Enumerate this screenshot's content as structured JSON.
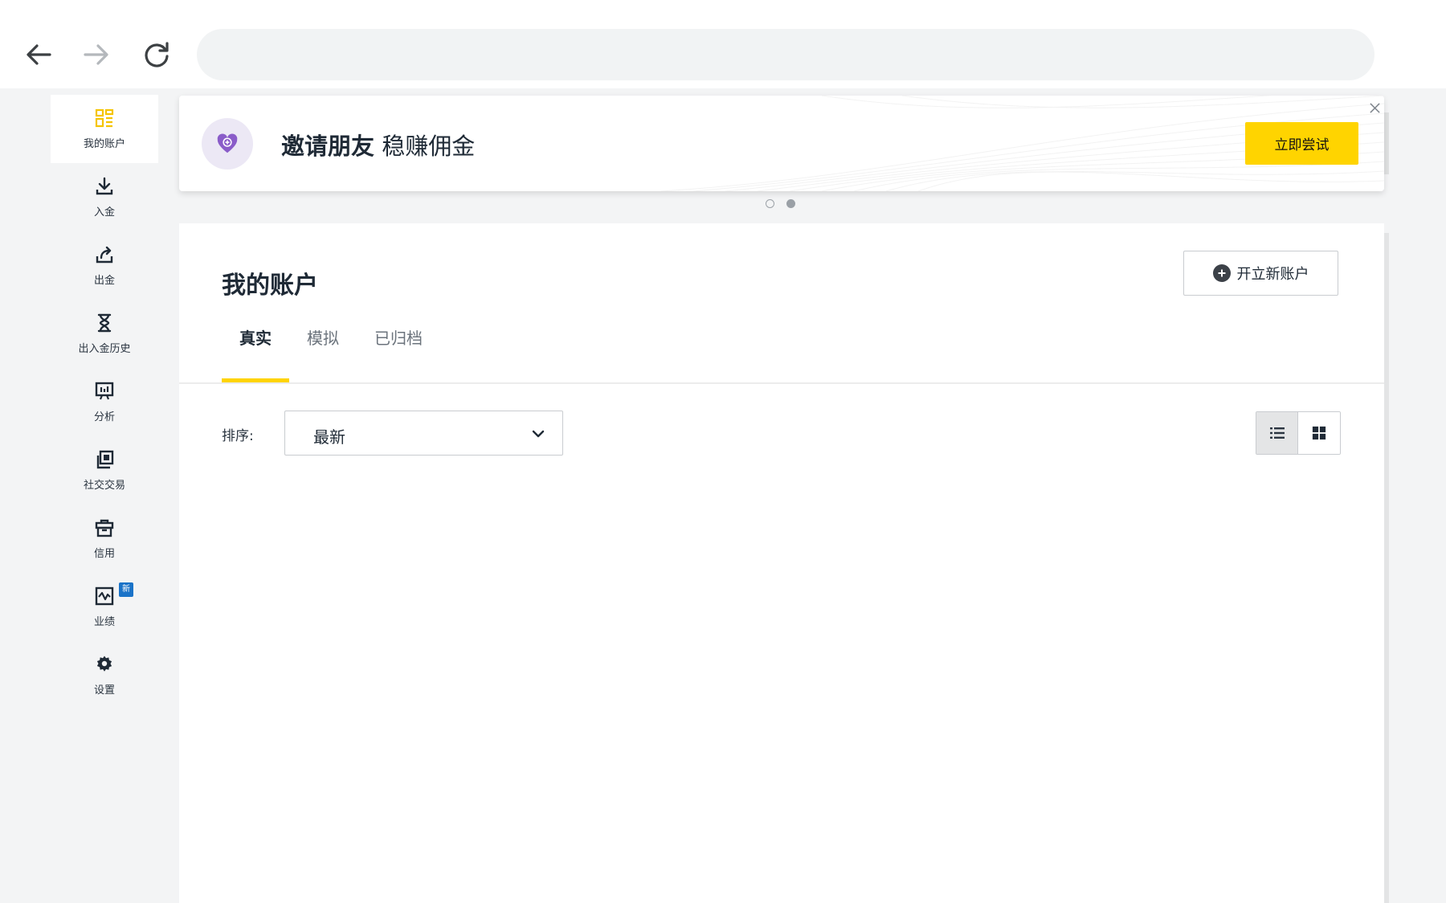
{
  "browser": {
    "back_icon": "arrow-left-icon",
    "forward_icon": "arrow-right-icon",
    "reload_icon": "reload-icon",
    "address_value": ""
  },
  "sidebar": {
    "items": [
      {
        "label": "我的账户",
        "icon": "dashboard-icon",
        "active": true
      },
      {
        "label": "入金",
        "icon": "download-icon"
      },
      {
        "label": "出金",
        "icon": "upload-icon"
      },
      {
        "label": "出入金历史",
        "icon": "hourglass-icon"
      },
      {
        "label": "分析",
        "icon": "chart-board-icon"
      },
      {
        "label": "社交交易",
        "icon": "copy-icon"
      },
      {
        "label": "信用",
        "icon": "briefcase-icon"
      },
      {
        "label": "业绩",
        "icon": "performance-icon",
        "badge": "新"
      },
      {
        "label": "设置",
        "icon": "gear-icon"
      }
    ]
  },
  "promo": {
    "title_bold": "邀请朋友",
    "title_rest": "稳赚佣金",
    "cta_label": "立即尝试",
    "close_icon": "close-icon"
  },
  "carousel": {
    "count": 2,
    "active_index": 1
  },
  "main": {
    "title": "我的账户",
    "open_account_label": "开立新账户",
    "tabs": [
      {
        "label": "真实",
        "active": true
      },
      {
        "label": "模拟"
      },
      {
        "label": "已归档"
      }
    ],
    "sort_label": "排序:",
    "sort_value": "最新",
    "view_modes": [
      "list",
      "grid"
    ],
    "active_view": "list"
  },
  "colors": {
    "accent": "#ffd400",
    "badge_blue": "#1a73c8",
    "promo_icon_purple": "#8a5cc9"
  }
}
